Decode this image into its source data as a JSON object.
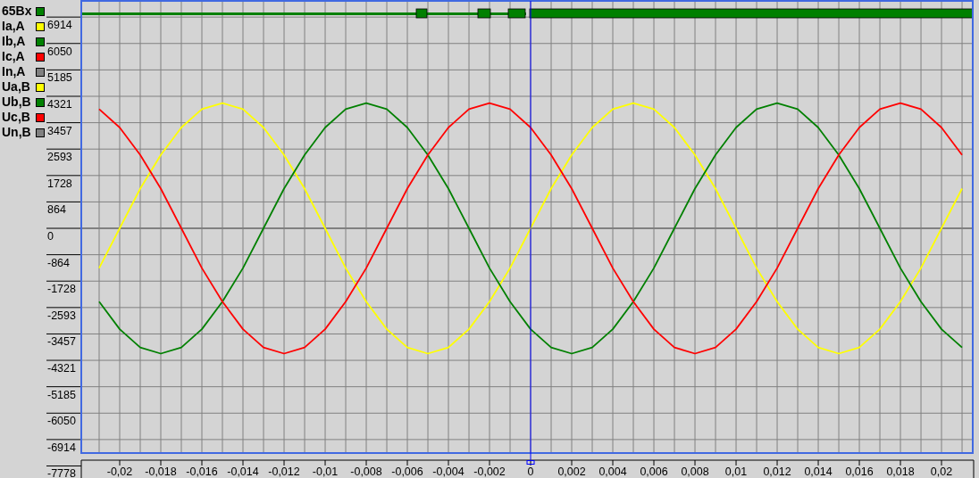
{
  "legend": [
    {
      "label": "65Bx",
      "color": "#008000"
    },
    {
      "label": "Ia,A",
      "color": "#ffff00"
    },
    {
      "label": "Ib,A",
      "color": "#008000"
    },
    {
      "label": "Ic,A",
      "color": "#ff0000"
    },
    {
      "label": "In,A",
      "color": "#808080"
    },
    {
      "label": "Ua,B",
      "color": "#ffff00"
    },
    {
      "label": "Ub,B",
      "color": "#008000"
    },
    {
      "label": "Uc,B",
      "color": "#ff0000"
    },
    {
      "label": "Un,B",
      "color": "#808080"
    }
  ],
  "chart_data": {
    "type": "line",
    "x": [
      -0.021,
      -0.02,
      -0.019,
      -0.018,
      -0.017,
      -0.016,
      -0.015,
      -0.014,
      -0.013,
      -0.012,
      -0.011,
      -0.01,
      -0.009,
      -0.008,
      -0.007,
      -0.006,
      -0.005,
      -0.004,
      -0.003,
      -0.002,
      -0.001,
      0,
      0.001,
      0.002,
      0.003,
      0.004,
      0.005,
      0.006,
      0.007,
      0.008,
      0.009,
      0.01,
      0.011,
      0.012,
      0.013,
      0.014,
      0.015,
      0.016,
      0.017,
      0.018,
      0.019,
      0.02,
      0.021
    ],
    "series": [
      {
        "color": "#ffff00",
        "values": [
          -1300,
          0,
          1300,
          2400,
          3300,
          3900,
          4100,
          3900,
          3300,
          2400,
          1300,
          0,
          -1300,
          -2400,
          -3300,
          -3900,
          -4100,
          -3900,
          -3300,
          -2400,
          -1300,
          0,
          1300,
          2400,
          3300,
          3900,
          4100,
          3900,
          3300,
          2400,
          1300,
          0,
          -1300,
          -2400,
          -3300,
          -3900,
          -4100,
          -3900,
          -3300,
          -2400,
          -1300,
          0,
          1300
        ]
      },
      {
        "color": "#008000",
        "values": [
          -2400,
          -3300,
          -3900,
          -4100,
          -3900,
          -3300,
          -2400,
          -1300,
          0,
          1300,
          2400,
          3300,
          3900,
          4100,
          3900,
          3300,
          2400,
          1300,
          0,
          -1300,
          -2400,
          -3300,
          -3900,
          -4100,
          -3900,
          -3300,
          -2400,
          -1300,
          0,
          1300,
          2400,
          3300,
          3900,
          4100,
          3900,
          3300,
          2400,
          1300,
          0,
          -1300,
          -2400,
          -3300,
          -3900
        ]
      },
      {
        "color": "#ff0000",
        "values": [
          3900,
          3300,
          2400,
          1300,
          0,
          -1300,
          -2400,
          -3300,
          -3900,
          -4100,
          -3900,
          -3300,
          -2400,
          -1300,
          0,
          1300,
          2400,
          3300,
          3900,
          4100,
          3900,
          3300,
          2400,
          1300,
          0,
          -1300,
          -2400,
          -3300,
          -3900,
          -4100,
          -3900,
          -3300,
          -2400,
          -1300,
          0,
          1300,
          2400,
          3300,
          3900,
          4100,
          3900,
          3300,
          2400
        ]
      }
    ],
    "xlim": [
      -0.02187,
      0.02152
    ],
    "ylim": [
      -7778,
      7473
    ],
    "grid": true,
    "ref_lines": [
      {
        "axis": "x",
        "value": 0,
        "color": "#0000ff"
      }
    ],
    "xticks": [
      {
        "value": -0.02,
        "label": "-0,02"
      },
      {
        "value": -0.018,
        "label": "-0,018"
      },
      {
        "value": -0.016,
        "label": "-0,016"
      },
      {
        "value": -0.014,
        "label": "-0,014"
      },
      {
        "value": -0.012,
        "label": "-0,012"
      },
      {
        "value": -0.01,
        "label": "-0,01"
      },
      {
        "value": -0.008,
        "label": "-0,008"
      },
      {
        "value": -0.006,
        "label": "-0,006"
      },
      {
        "value": -0.004,
        "label": "-0,004"
      },
      {
        "value": -0.002,
        "label": "-0,002"
      },
      {
        "value": 0,
        "label": "0"
      },
      {
        "value": 0.002,
        "label": "0,002"
      },
      {
        "value": 0.004,
        "label": "0,004"
      },
      {
        "value": 0.006,
        "label": "0,006"
      },
      {
        "value": 0.008,
        "label": "0,008"
      },
      {
        "value": 0.01,
        "label": "0,01"
      },
      {
        "value": 0.012,
        "label": "0,012"
      },
      {
        "value": 0.014,
        "label": "0,014"
      },
      {
        "value": 0.016,
        "label": "0,016"
      },
      {
        "value": 0.018,
        "label": "0,018"
      },
      {
        "value": 0.02,
        "label": "0,02"
      }
    ],
    "yticks": [
      6914,
      6050,
      5185,
      4321,
      3457,
      2593,
      1728,
      864,
      0,
      -864,
      -1728,
      -2593,
      -3457,
      -4321,
      -5185,
      -6050,
      -6914,
      -7778
    ]
  }
}
